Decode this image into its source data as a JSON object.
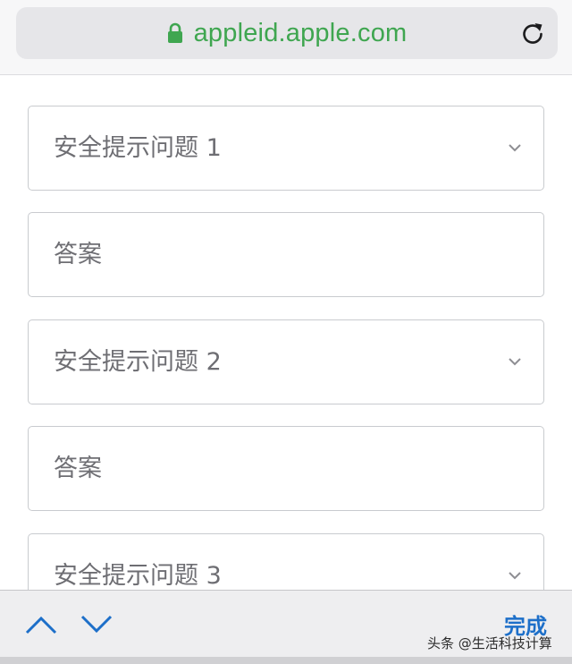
{
  "address_bar": {
    "url": "appleid.apple.com",
    "lock_icon": "lock-icon",
    "reload_icon": "reload-icon",
    "url_color": "#3fa650"
  },
  "form": {
    "fields": [
      {
        "type": "select",
        "placeholder": "安全提示问题 1"
      },
      {
        "type": "input",
        "placeholder": "答案"
      },
      {
        "type": "select",
        "placeholder": "安全提示问题 2"
      },
      {
        "type": "input",
        "placeholder": "答案"
      },
      {
        "type": "select",
        "placeholder": "安全提示问题 3"
      }
    ]
  },
  "keyboard_toolbar": {
    "prev_icon": "chevron-up-icon",
    "next_icon": "chevron-down-icon",
    "done_label": "完成",
    "accent_color": "#1d6fc9"
  },
  "watermark": {
    "text": "头条 @生活科技计算"
  }
}
